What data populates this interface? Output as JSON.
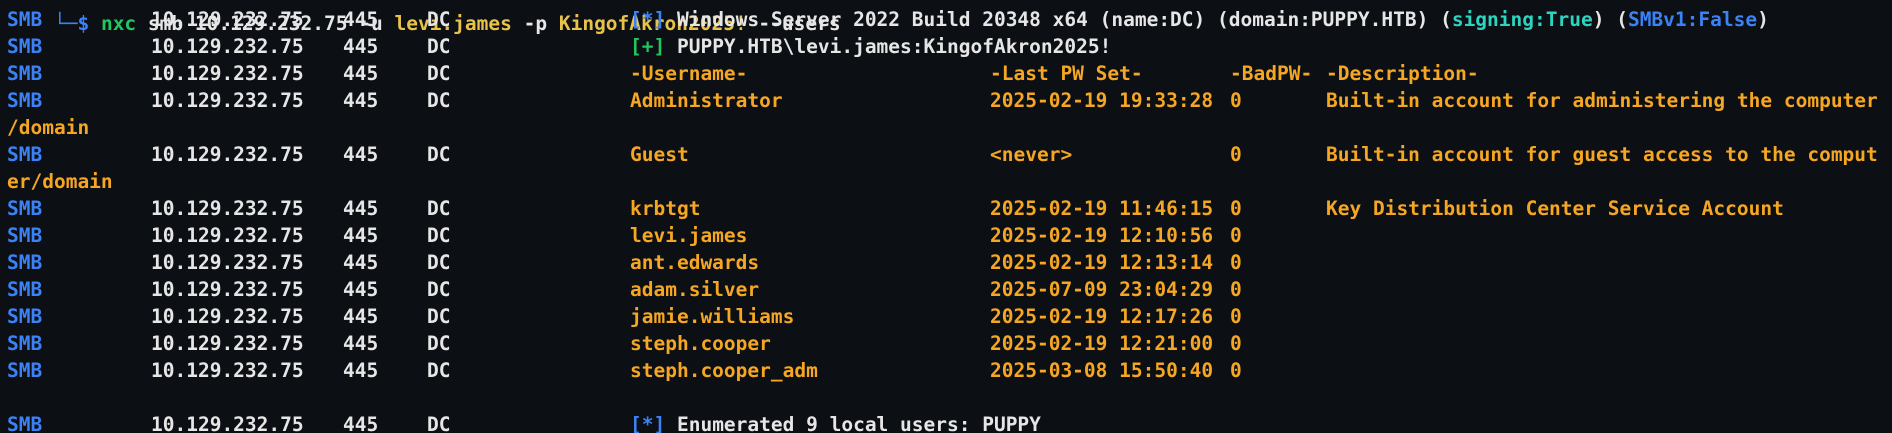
{
  "top_cmd": {
    "prompt": "└─$",
    "tool": "nxc",
    "rest": " smb 10.129.232.75 -u ",
    "user": "levi.james",
    "pflag": " -p ",
    "pass": "KingofAkron2025!",
    "flag": " --users"
  },
  "colors": {
    "background": "#0c0f14",
    "protocol": "#3b82f6",
    "status_info": "#3b82f6",
    "status_ok": "#22c55e",
    "signing": "#2dd4bf",
    "table": "#f5a623",
    "text": "#e6e6e6"
  },
  "proto": "SMB",
  "ip": "10.129.232.75",
  "port": "445",
  "host": "DC",
  "info_line": {
    "marker": "[*]",
    "text": " Windows Server 2022 Build 20348 x64 (name:DC) (domain:PUPPY.HTB) (",
    "signing": "signing:True",
    "mid": ") (",
    "smbv1": "SMBv1:False",
    "end": ")"
  },
  "auth_line": {
    "marker": "[+]",
    "text": " PUPPY.HTB\\levi.james:KingofAkron2025!"
  },
  "table_header": {
    "username": "-Username-",
    "last_pw_set": "-Last PW Set-",
    "badpw": "-BadPW-",
    "description": "-Description-"
  },
  "users": [
    {
      "username": "Administrator",
      "last_pw_set": "2025-02-19 19:33:28",
      "badpw": "0",
      "description": "Built-in account for administering the computer",
      "wrap": "/domain"
    },
    {
      "username": "Guest",
      "last_pw_set": "<never>",
      "badpw": "0",
      "description": "Built-in account for guest access to the comput",
      "wrap": "er/domain"
    },
    {
      "username": "krbtgt",
      "last_pw_set": "2025-02-19 11:46:15",
      "badpw": "0",
      "description": "Key Distribution Center Service Account",
      "wrap": ""
    },
    {
      "username": "levi.james",
      "last_pw_set": "2025-02-19 12:10:56",
      "badpw": "0",
      "description": "",
      "wrap": ""
    },
    {
      "username": "ant.edwards",
      "last_pw_set": "2025-02-19 12:13:14",
      "badpw": "0",
      "description": "",
      "wrap": ""
    },
    {
      "username": "adam.silver",
      "last_pw_set": "2025-07-09 23:04:29",
      "badpw": "0",
      "description": "",
      "wrap": ""
    },
    {
      "username": "jamie.williams",
      "last_pw_set": "2025-02-19 12:17:26",
      "badpw": "0",
      "description": "",
      "wrap": ""
    },
    {
      "username": "steph.cooper",
      "last_pw_set": "2025-02-19 12:21:00",
      "badpw": "0",
      "description": "",
      "wrap": ""
    },
    {
      "username": "steph.cooper_adm",
      "last_pw_set": "2025-03-08 15:50:40",
      "badpw": "0",
      "description": "",
      "wrap": ""
    }
  ],
  "summary_line": {
    "marker": "[*]",
    "text": " Enumerated 9 local users: PUPPY"
  }
}
